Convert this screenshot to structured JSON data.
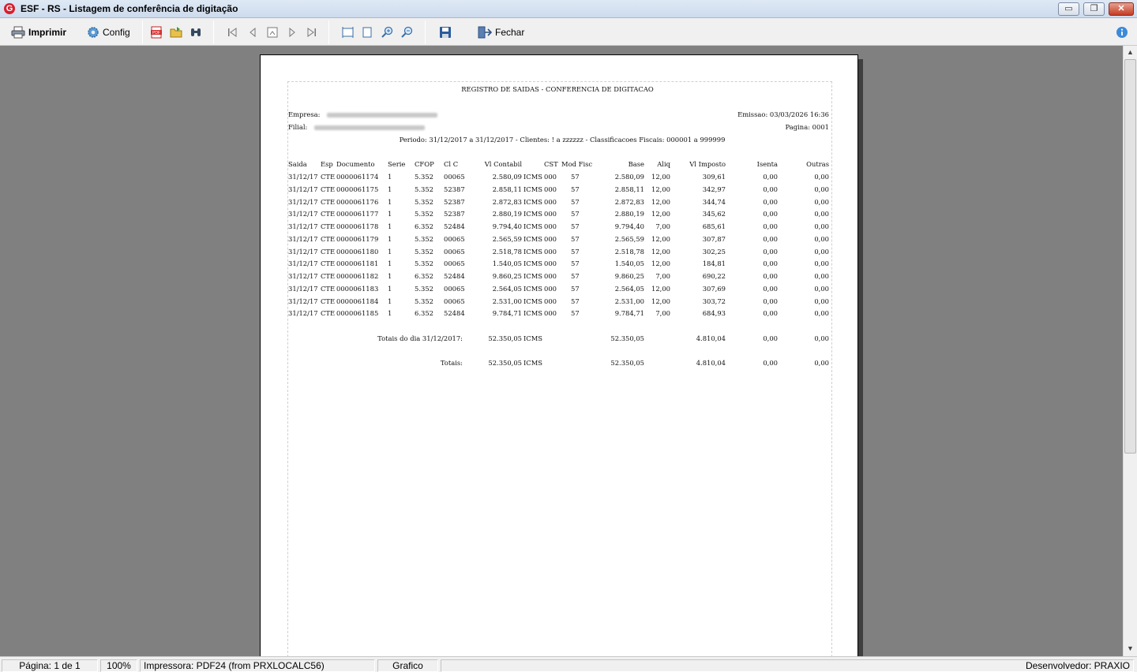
{
  "window": {
    "title": "ESF - RS - Listagem de conferência de digitação",
    "app_icon": "G",
    "min_icon": "▭",
    "max_icon": "❐",
    "close_icon": "✕"
  },
  "toolbar": {
    "print_label": "Imprimir",
    "config_label": "Config",
    "close_label": "Fechar",
    "icons": [
      "printer-icon",
      "gear-icon",
      "pdf-icon",
      "open-folder-icon",
      "binoculars-icon",
      "first-page-icon",
      "prev-page-icon",
      "goto-page-icon",
      "next-page-icon",
      "last-page-icon",
      "page-width-icon",
      "whole-page-icon",
      "zoom-in-icon",
      "zoom-out-icon",
      "save-icon",
      "exit-icon",
      "info-icon"
    ]
  },
  "report": {
    "title": "REGISTRO DE SAIDAS - CONFERENCIA DE DIGITACAO",
    "empresa_label": "Empresa:",
    "filial_label": "Filial:",
    "emissao": "Emissao: 03/03/2026 16:36",
    "pagina": "Pagina: 0001",
    "periodo": "Periodo: 31/12/2017 a 31/12/2017 - Clientes: ! a zzzzzz - Classificacoes Fiscais: 000001 a 999999",
    "headers": {
      "saida": "Saida",
      "esp": "Esp",
      "documento": "Documento",
      "serie": "Serie",
      "cfop": "CFOP",
      "clc": "Cl C",
      "vlcontabil": "Vl Contabil",
      "cst": "CST",
      "modfisc": "Mod Fisc",
      "base": "Base",
      "aliq": "Aliq",
      "vlimposto": "Vl Imposto",
      "isenta": "Isenta",
      "outras": "Outras"
    },
    "rows": [
      {
        "saida": "31/12/17",
        "esp": "CTE",
        "documento": "0000061174",
        "serie": "1",
        "cfop": "5.352",
        "clc": "00065",
        "vlcontabil": "2.580,09",
        "imp": "ICMS",
        "cst": "000",
        "modfisc": "57",
        "base": "2.580,09",
        "aliq": "12,00",
        "vlimposto": "309,61",
        "isenta": "0,00",
        "outras": "0,00"
      },
      {
        "saida": "31/12/17",
        "esp": "CTE",
        "documento": "0000061175",
        "serie": "1",
        "cfop": "5.352",
        "clc": "52387",
        "vlcontabil": "2.858,11",
        "imp": "ICMS",
        "cst": "000",
        "modfisc": "57",
        "base": "2.858,11",
        "aliq": "12,00",
        "vlimposto": "342,97",
        "isenta": "0,00",
        "outras": "0,00"
      },
      {
        "saida": "31/12/17",
        "esp": "CTE",
        "documento": "0000061176",
        "serie": "1",
        "cfop": "5.352",
        "clc": "52387",
        "vlcontabil": "2.872,83",
        "imp": "ICMS",
        "cst": "000",
        "modfisc": "57",
        "base": "2.872,83",
        "aliq": "12,00",
        "vlimposto": "344,74",
        "isenta": "0,00",
        "outras": "0,00"
      },
      {
        "saida": "31/12/17",
        "esp": "CTE",
        "documento": "0000061177",
        "serie": "1",
        "cfop": "5.352",
        "clc": "52387",
        "vlcontabil": "2.880,19",
        "imp": "ICMS",
        "cst": "000",
        "modfisc": "57",
        "base": "2.880,19",
        "aliq": "12,00",
        "vlimposto": "345,62",
        "isenta": "0,00",
        "outras": "0,00"
      },
      {
        "saida": "31/12/17",
        "esp": "CTE",
        "documento": "0000061178",
        "serie": "1",
        "cfop": "6.352",
        "clc": "52484",
        "vlcontabil": "9.794,40",
        "imp": "ICMS",
        "cst": "000",
        "modfisc": "57",
        "base": "9.794,40",
        "aliq": "7,00",
        "vlimposto": "685,61",
        "isenta": "0,00",
        "outras": "0,00"
      },
      {
        "saida": "31/12/17",
        "esp": "CTE",
        "documento": "0000061179",
        "serie": "1",
        "cfop": "5.352",
        "clc": "00065",
        "vlcontabil": "2.565,59",
        "imp": "ICMS",
        "cst": "000",
        "modfisc": "57",
        "base": "2.565,59",
        "aliq": "12,00",
        "vlimposto": "307,87",
        "isenta": "0,00",
        "outras": "0,00"
      },
      {
        "saida": "31/12/17",
        "esp": "CTE",
        "documento": "0000061180",
        "serie": "1",
        "cfop": "5.352",
        "clc": "00065",
        "vlcontabil": "2.518,78",
        "imp": "ICMS",
        "cst": "000",
        "modfisc": "57",
        "base": "2.518,78",
        "aliq": "12,00",
        "vlimposto": "302,25",
        "isenta": "0,00",
        "outras": "0,00"
      },
      {
        "saida": "31/12/17",
        "esp": "CTE",
        "documento": "0000061181",
        "serie": "1",
        "cfop": "5.352",
        "clc": "00065",
        "vlcontabil": "1.540,05",
        "imp": "ICMS",
        "cst": "000",
        "modfisc": "57",
        "base": "1.540,05",
        "aliq": "12,00",
        "vlimposto": "184,81",
        "isenta": "0,00",
        "outras": "0,00"
      },
      {
        "saida": "31/12/17",
        "esp": "CTE",
        "documento": "0000061182",
        "serie": "1",
        "cfop": "6.352",
        "clc": "52484",
        "vlcontabil": "9.860,25",
        "imp": "ICMS",
        "cst": "000",
        "modfisc": "57",
        "base": "9.860,25",
        "aliq": "7,00",
        "vlimposto": "690,22",
        "isenta": "0,00",
        "outras": "0,00"
      },
      {
        "saida": "31/12/17",
        "esp": "CTE",
        "documento": "0000061183",
        "serie": "1",
        "cfop": "5.352",
        "clc": "00065",
        "vlcontabil": "2.564,05",
        "imp": "ICMS",
        "cst": "000",
        "modfisc": "57",
        "base": "2.564,05",
        "aliq": "12,00",
        "vlimposto": "307,69",
        "isenta": "0,00",
        "outras": "0,00"
      },
      {
        "saida": "31/12/17",
        "esp": "CTE",
        "documento": "0000061184",
        "serie": "1",
        "cfop": "5.352",
        "clc": "00065",
        "vlcontabil": "2.531,00",
        "imp": "ICMS",
        "cst": "000",
        "modfisc": "57",
        "base": "2.531,00",
        "aliq": "12,00",
        "vlimposto": "303,72",
        "isenta": "0,00",
        "outras": "0,00"
      },
      {
        "saida": "31/12/17",
        "esp": "CTE",
        "documento": "0000061185",
        "serie": "1",
        "cfop": "6.352",
        "clc": "52484",
        "vlcontabil": "9.784,71",
        "imp": "ICMS",
        "cst": "000",
        "modfisc": "57",
        "base": "9.784,71",
        "aliq": "7,00",
        "vlimposto": "684,93",
        "isenta": "0,00",
        "outras": "0,00"
      }
    ],
    "totals_day": {
      "label": "Totais do dia 31/12/2017:",
      "vlcontabil": "52.350,05",
      "imp": "ICMS",
      "base": "52.350,05",
      "vlimposto": "4.810,04",
      "isenta": "0,00",
      "outras": "0,00"
    },
    "totals": {
      "label": "Totais:",
      "vlcontabil": "52.350,05",
      "imp": "ICMS",
      "base": "52.350,05",
      "vlimposto": "4.810,04",
      "isenta": "0,00",
      "outras": "0,00"
    }
  },
  "scrollbar": {
    "up_icon": "▲",
    "down_icon": "▼"
  },
  "status": {
    "page": "Página: 1 de 1",
    "zoom": "100%",
    "printer": "Impressora: PDF24 (from PRXLOCALC56)",
    "mode": "Grafico",
    "developer": "Desenvolvedor: PRAXIO"
  }
}
